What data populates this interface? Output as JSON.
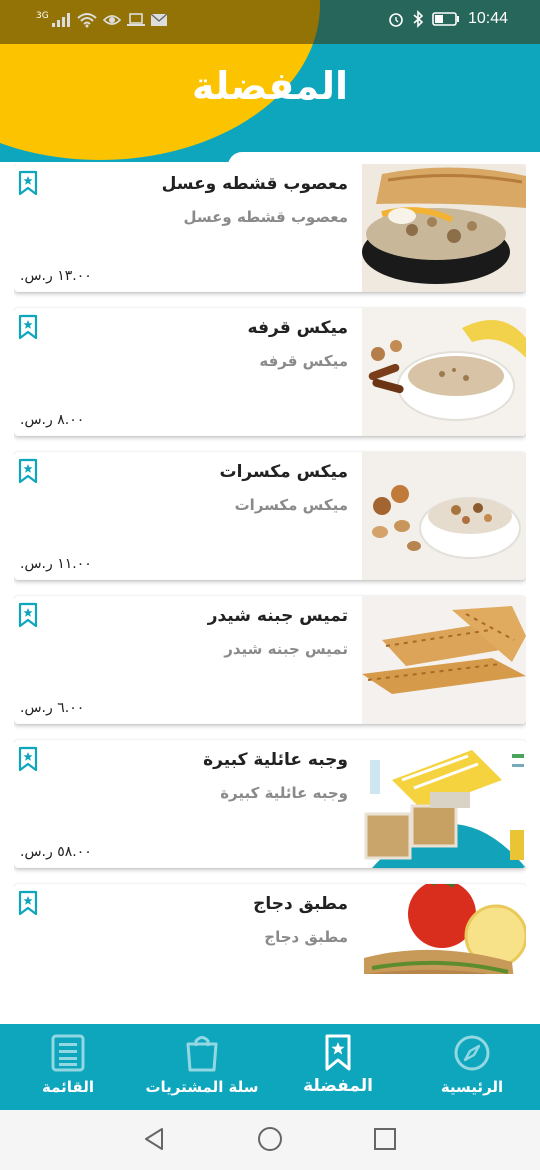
{
  "status_bar": {
    "time": "10:44",
    "network": "3G"
  },
  "page": {
    "title": "المفضلة"
  },
  "currency": "ر.س.",
  "items": [
    {
      "name": "معصوب قشطه وعسل",
      "description": "معصوب قشطه وعسل",
      "price": "١٣.٠٠"
    },
    {
      "name": "ميكس قرفه",
      "description": "ميكس قرفه",
      "price": "٨.٠٠"
    },
    {
      "name": "ميكس مكسرات",
      "description": "ميكس مكسرات",
      "price": "١١.٠٠"
    },
    {
      "name": "تميس جبنه شيدر",
      "description": "تميس جبنه شيدر",
      "price": "٦.٠٠"
    },
    {
      "name": "وجبه عائلية كبيرة",
      "description": "وجبه عائلية كبيرة",
      "price": "٥٨.٠٠"
    },
    {
      "name": "مطبق دجاج",
      "description": "مطبق دجاج",
      "price": ""
    }
  ],
  "bottom_nav": [
    {
      "label": "القائمة",
      "icon": "menu-list-icon"
    },
    {
      "label": "سلة المشتريات",
      "icon": "shopping-bag-icon"
    },
    {
      "label": "المفضلة",
      "icon": "bookmark-star-icon",
      "active": true
    },
    {
      "label": "الرئيسية",
      "icon": "compass-icon"
    }
  ],
  "colors": {
    "primary": "#0ea6bd",
    "accent": "#fcc400",
    "bookmark": "#0ea6bd"
  }
}
